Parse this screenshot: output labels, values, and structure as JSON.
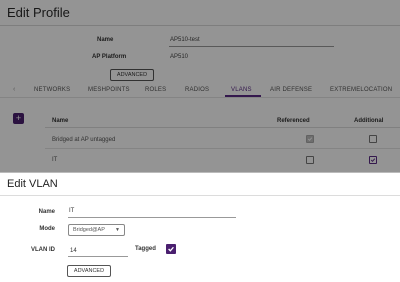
{
  "profile": {
    "title": "Edit Profile",
    "name_label": "Name",
    "name_value": "AP510-test",
    "platform_label": "AP Platform",
    "platform_value": "AP510",
    "advanced_label": "ADVANCED"
  },
  "tabs": [
    "NETWORKS",
    "MESHPOINTS",
    "ROLES",
    "RADIOS",
    "VLANS",
    "AIR DEFENSE",
    "EXTREMELOCATION"
  ],
  "active_tab": "VLANS",
  "vlan_table": {
    "headers": {
      "name": "Name",
      "referenced": "Referenced",
      "additional": "Additional"
    },
    "rows": [
      {
        "name": "Bridged at AP untagged",
        "referenced": true,
        "referenced_disabled": true,
        "additional": false
      },
      {
        "name": "IT",
        "referenced": false,
        "referenced_disabled": false,
        "additional": true
      }
    ]
  },
  "modal": {
    "title": "Edit VLAN",
    "name_label": "Name",
    "name_value": "IT",
    "mode_label": "Mode",
    "mode_value": "Bridged@AP",
    "vlan_id_label": "VLAN ID",
    "vlan_id_value": "14",
    "tagged_label": "Tagged",
    "tagged_checked": true,
    "advanced_label": "ADVANCED"
  },
  "colors": {
    "accent": "#5b2a86",
    "accent_dark": "#4a1f6f",
    "overlay": "rgba(0,0,0,0.42)"
  },
  "icons": {
    "add": "plus-icon",
    "tab_prev": "chevron-left-icon",
    "checkbox_check": "check-icon",
    "select_caret": "caret-down-icon"
  }
}
